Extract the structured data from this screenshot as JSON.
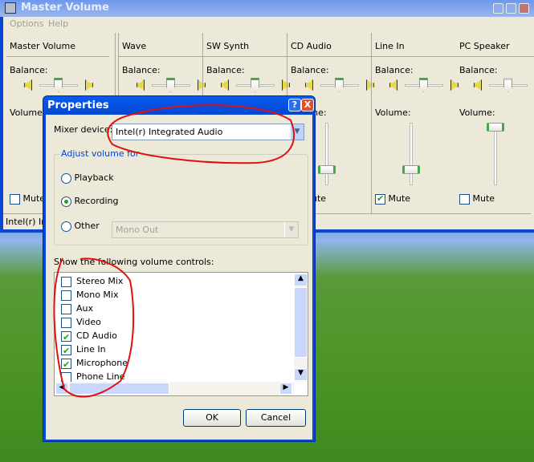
{
  "master_window": {
    "title": "Master Volume",
    "menu": [
      "Options",
      "Help"
    ],
    "balance_label": "Balance:",
    "volume_label": "Volume:",
    "mute_label": "Mute",
    "channels": [
      {
        "name": "Master Volume",
        "balance": 0,
        "muted": false
      },
      {
        "name": "Wave",
        "balance": 0
      },
      {
        "name": "SW Synth",
        "balance": 0
      },
      {
        "name": "CD Audio",
        "balance": 0,
        "volume": 0.25,
        "muted": false
      },
      {
        "name": "Line In",
        "balance": 0,
        "volume": 0.25,
        "muted": true
      },
      {
        "name": "PC Speaker",
        "balance": 0,
        "volume": 1.0,
        "muted": false
      }
    ],
    "status": "Intel(r) In"
  },
  "dialog": {
    "title": "Properties",
    "help_button": "?",
    "close_button": "X",
    "mixer_device_label": "Mixer device:",
    "mixer_device_value": "Intel(r) Integrated Audio",
    "adjust_group_label": "Adjust volume for",
    "options": {
      "playback": "Playback",
      "recording": "Recording",
      "other": "Other"
    },
    "selected": "Recording",
    "other_value": "Mono Out",
    "controls_label": "Show the following volume controls:",
    "controls": [
      {
        "label": "Stereo Mix",
        "checked": false
      },
      {
        "label": "Mono Mix",
        "checked": false
      },
      {
        "label": "Aux",
        "checked": false
      },
      {
        "label": "Video",
        "checked": false
      },
      {
        "label": "CD Audio",
        "checked": true
      },
      {
        "label": "Line In",
        "checked": true
      },
      {
        "label": "Microphone",
        "checked": true
      },
      {
        "label": "Phone Line",
        "checked": false
      }
    ],
    "ok": "OK",
    "cancel": "Cancel"
  },
  "colors": {
    "xp_blue": "#0a46d6",
    "dialog_bg": "#ece9d8",
    "annotation": "#e01010"
  }
}
